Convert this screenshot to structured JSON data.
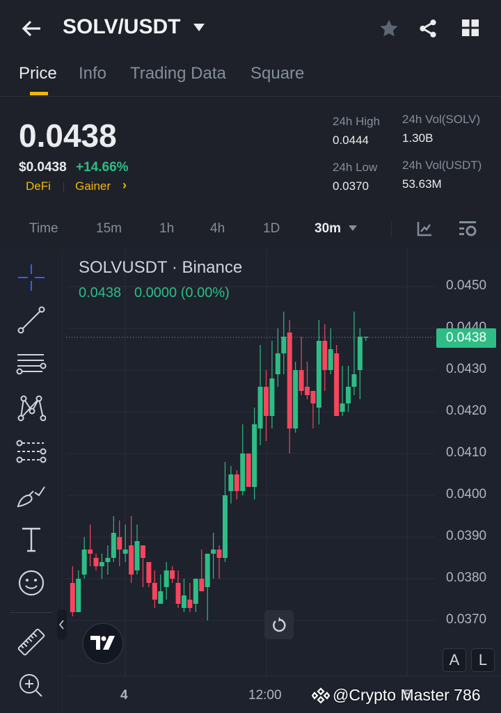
{
  "header": {
    "title": "SOLV/USDT"
  },
  "tabs": [
    {
      "label": "Price"
    },
    {
      "label": "Info"
    },
    {
      "label": "Trading Data"
    },
    {
      "label": "Square"
    }
  ],
  "price": {
    "last": "0.0438",
    "usd": "$0.0438",
    "change": "+14.66%",
    "tag1": "DeFi",
    "tag2": "Gainer",
    "tag_arrow": "›"
  },
  "stats": {
    "high_label": "24h High",
    "high": "0.0444",
    "low_label": "24h Low",
    "low": "0.0370",
    "vol_base_label": "24h Vol(SOLV)",
    "vol_base": "1.30B",
    "vol_quote_label": "24h Vol(USDT)",
    "vol_quote": "53.63M"
  },
  "intervals": [
    "Time",
    "15m",
    "1h",
    "4h",
    "1D",
    "30m"
  ],
  "chart": {
    "symbol": "SOLVUSDT · Binance",
    "ohlc_price": "0.0438",
    "ohlc_change": "0.0000 (0.00%)",
    "current_label": "0.0438",
    "price_labels": [
      "0.0450",
      "0.0440",
      "0.0430",
      "0.0420",
      "0.0410",
      "0.0400",
      "0.0390",
      "0.0380",
      "0.0370"
    ],
    "time_labels": [
      "4",
      "12:00",
      "5"
    ],
    "btn_a": "A",
    "btn_l": "L",
    "logo": "TV"
  },
  "watermark": "@Crypto Master 786",
  "colors": {
    "up": "#2ebd85",
    "down": "#f6465d",
    "accent": "#f0b90b",
    "bg": "#1e2129"
  },
  "chart_data": {
    "type": "candlestick",
    "interval": "30m",
    "ylim": [
      0.0365,
      0.0455
    ],
    "candles": [
      [
        0.0379,
        0.0383,
        0.0371,
        0.0372
      ],
      [
        0.0372,
        0.0382,
        0.0372,
        0.038
      ],
      [
        0.0381,
        0.039,
        0.038,
        0.0387
      ],
      [
        0.0387,
        0.0393,
        0.0383,
        0.0386
      ],
      [
        0.0385,
        0.0386,
        0.0382,
        0.0383
      ],
      [
        0.0383,
        0.0386,
        0.038,
        0.0384
      ],
      [
        0.0384,
        0.0388,
        0.0381,
        0.0385
      ],
      [
        0.0385,
        0.0395,
        0.0384,
        0.0391
      ],
      [
        0.039,
        0.0394,
        0.0383,
        0.0387
      ],
      [
        0.0386,
        0.0393,
        0.0384,
        0.0387
      ],
      [
        0.0388,
        0.0395,
        0.0379,
        0.0381
      ],
      [
        0.0382,
        0.0393,
        0.0381,
        0.0389
      ],
      [
        0.0388,
        0.0388,
        0.0378,
        0.0385
      ],
      [
        0.0384,
        0.0384,
        0.0378,
        0.0379
      ],
      [
        0.0379,
        0.0382,
        0.0373,
        0.0375
      ],
      [
        0.0374,
        0.0381,
        0.0374,
        0.0377
      ],
      [
        0.0378,
        0.0384,
        0.0375,
        0.0382
      ],
      [
        0.0382,
        0.0383,
        0.0379,
        0.038
      ],
      [
        0.0379,
        0.0382,
        0.0373,
        0.0374
      ],
      [
        0.0373,
        0.038,
        0.0372,
        0.0376
      ],
      [
        0.0375,
        0.0379,
        0.0372,
        0.0373
      ],
      [
        0.0374,
        0.038,
        0.0372,
        0.038
      ],
      [
        0.038,
        0.0387,
        0.0377,
        0.0377
      ],
      [
        0.0378,
        0.0386,
        0.037,
        0.0386
      ],
      [
        0.0386,
        0.0391,
        0.038,
        0.0387
      ],
      [
        0.0387,
        0.0388,
        0.038,
        0.0385
      ],
      [
        0.0385,
        0.0408,
        0.0384,
        0.04
      ],
      [
        0.0401,
        0.0407,
        0.0398,
        0.0405
      ],
      [
        0.0405,
        0.0406,
        0.0399,
        0.0401
      ],
      [
        0.0401,
        0.0417,
        0.04,
        0.041
      ],
      [
        0.041,
        0.041,
        0.0402,
        0.0402
      ],
      [
        0.0402,
        0.0421,
        0.0399,
        0.0417
      ],
      [
        0.0416,
        0.0436,
        0.0412,
        0.0426
      ],
      [
        0.0426,
        0.043,
        0.0413,
        0.0419
      ],
      [
        0.0419,
        0.0437,
        0.0416,
        0.0428
      ],
      [
        0.0429,
        0.044,
        0.0426,
        0.0434
      ],
      [
        0.0434,
        0.0444,
        0.0429,
        0.0438
      ],
      [
        0.0439,
        0.0442,
        0.041,
        0.0416
      ],
      [
        0.0416,
        0.0432,
        0.0415,
        0.043
      ],
      [
        0.043,
        0.0438,
        0.0424,
        0.0425
      ],
      [
        0.0426,
        0.0432,
        0.0423,
        0.0424
      ],
      [
        0.0425,
        0.0425,
        0.0416,
        0.0422
      ],
      [
        0.0421,
        0.0442,
        0.0417,
        0.0437
      ],
      [
        0.0437,
        0.0441,
        0.0425,
        0.043
      ],
      [
        0.043,
        0.044,
        0.0429,
        0.0435
      ],
      [
        0.0434,
        0.0436,
        0.0419,
        0.0419
      ],
      [
        0.042,
        0.0431,
        0.0419,
        0.0422
      ],
      [
        0.0422,
        0.0431,
        0.042,
        0.0426
      ],
      [
        0.0426,
        0.0444,
        0.0424,
        0.0429
      ],
      [
        0.043,
        0.044,
        0.0423,
        0.0438
      ],
      [
        0.0438,
        0.0438,
        0.0437,
        0.0438
      ]
    ]
  }
}
